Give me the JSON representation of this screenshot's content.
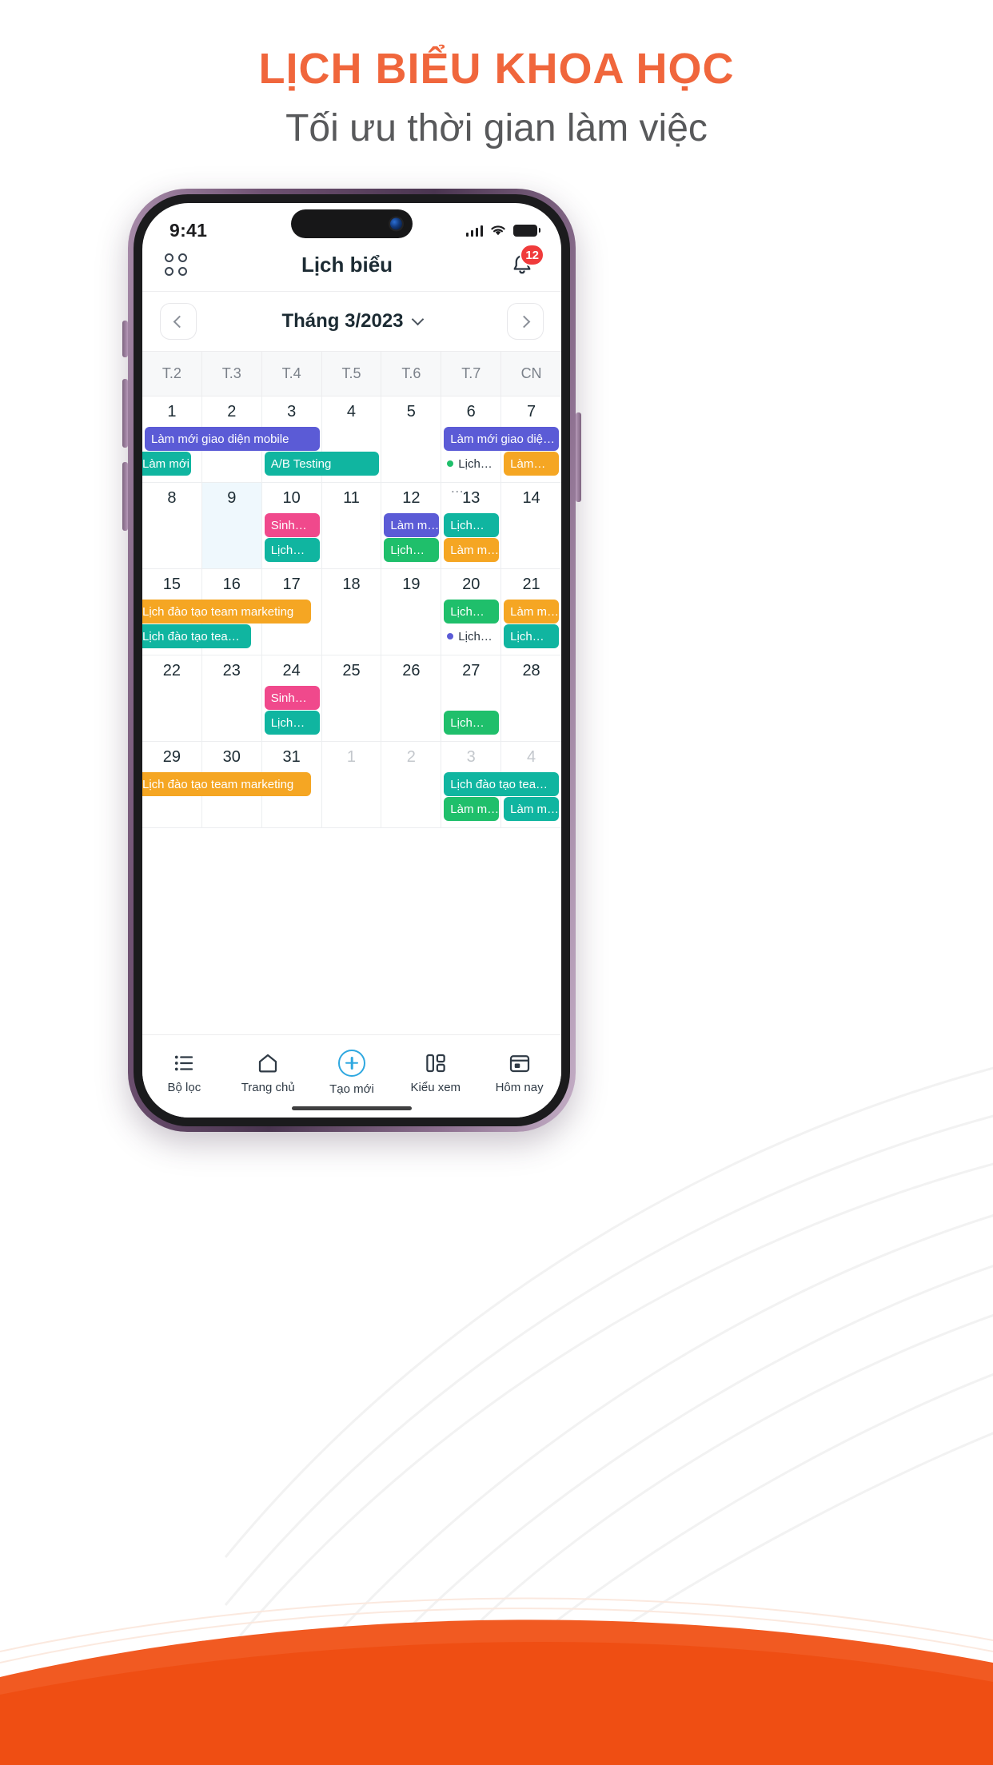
{
  "page": {
    "headline": "LỊCH BIỂU KHOA HỌC",
    "subhead": "Tối ưu thời gian làm việc",
    "accent_color": "#F0663C",
    "subhead_color": "#58595B"
  },
  "status_bar": {
    "time": "9:41",
    "signal_icon": "cellular-bars-icon",
    "wifi_icon": "wifi-icon",
    "battery_icon": "battery-icon"
  },
  "app_bar": {
    "grid_icon": "grid-apps-icon",
    "title": "Lịch biểu",
    "bell_icon": "bell-icon",
    "notification_count": "12",
    "badge_color": "#F03B3B"
  },
  "month_nav": {
    "prev_icon": "chevron-left-icon",
    "next_icon": "chevron-right-icon",
    "label": "Tháng 3/2023",
    "dropdown_icon": "chevron-down-icon"
  },
  "weekdays": [
    "T.2",
    "T.3",
    "T.4",
    "T.5",
    "T.6",
    "T.7",
    "CN"
  ],
  "days": [
    {
      "n": "1",
      "muted": false,
      "today": false
    },
    {
      "n": "2",
      "muted": false,
      "today": false
    },
    {
      "n": "3",
      "muted": false,
      "today": false
    },
    {
      "n": "4",
      "muted": false,
      "today": false
    },
    {
      "n": "5",
      "muted": false,
      "today": false
    },
    {
      "n": "6",
      "muted": false,
      "today": false
    },
    {
      "n": "7",
      "muted": false,
      "today": false
    },
    {
      "n": "8",
      "muted": false,
      "today": false
    },
    {
      "n": "9",
      "muted": false,
      "today": true
    },
    {
      "n": "10",
      "muted": false,
      "today": false
    },
    {
      "n": "11",
      "muted": false,
      "today": false
    },
    {
      "n": "12",
      "muted": false,
      "today": false
    },
    {
      "n": "13",
      "muted": false,
      "today": false
    },
    {
      "n": "14",
      "muted": false,
      "today": false
    },
    {
      "n": "15",
      "muted": false,
      "today": false
    },
    {
      "n": "16",
      "muted": false,
      "today": false
    },
    {
      "n": "17",
      "muted": false,
      "today": false
    },
    {
      "n": "18",
      "muted": false,
      "today": false
    },
    {
      "n": "19",
      "muted": false,
      "today": false
    },
    {
      "n": "20",
      "muted": false,
      "today": false
    },
    {
      "n": "21",
      "muted": false,
      "today": false
    },
    {
      "n": "22",
      "muted": false,
      "today": false
    },
    {
      "n": "23",
      "muted": false,
      "today": false
    },
    {
      "n": "24",
      "muted": false,
      "today": false
    },
    {
      "n": "25",
      "muted": false,
      "today": false
    },
    {
      "n": "26",
      "muted": false,
      "today": false
    },
    {
      "n": "27",
      "muted": false,
      "today": false
    },
    {
      "n": "28",
      "muted": false,
      "today": false
    },
    {
      "n": "29",
      "muted": false,
      "today": false
    },
    {
      "n": "30",
      "muted": false,
      "today": false
    },
    {
      "n": "31",
      "muted": false,
      "today": false
    },
    {
      "n": "1",
      "muted": true,
      "today": false
    },
    {
      "n": "2",
      "muted": true,
      "today": false
    },
    {
      "n": "3",
      "muted": true,
      "today": false
    },
    {
      "n": "4",
      "muted": true,
      "today": false
    }
  ],
  "event_colors": {
    "purple": "#5B5BD6",
    "teal": "#10B5A0",
    "green": "#1FBF6B",
    "orange": "#F5A623",
    "pink": "#F0498C"
  },
  "events": [
    {
      "label": "Làm mới giao diện mobile",
      "color": "#5B5BD6",
      "row": 0,
      "lane": 0,
      "col": 0,
      "span": 3,
      "style": "chip"
    },
    {
      "label": "Làm mới giao…",
      "color": "#10B5A0",
      "row": 0,
      "lane": 1,
      "col": 0,
      "span": 1,
      "style": "chip",
      "bleedLeft": true
    },
    {
      "label": "A/B Testing",
      "color": "#10B5A0",
      "row": 0,
      "lane": 1,
      "col": 2,
      "span": 2,
      "style": "chip"
    },
    {
      "label": "Làm mới giao diệ…",
      "color": "#5B5BD6",
      "row": 0,
      "lane": 0,
      "col": 5,
      "span": 2,
      "style": "chip"
    },
    {
      "label": "Lịch…",
      "color": "#1FBF6B",
      "row": 0,
      "lane": 1,
      "col": 5,
      "span": 1,
      "style": "dot"
    },
    {
      "label": "Làm…",
      "color": "#F5A623",
      "row": 0,
      "lane": 1,
      "col": 6,
      "span": 1,
      "style": "chip"
    },
    {
      "label": "…",
      "color": "#7b818a",
      "row": 0,
      "lane": 2,
      "col": 5,
      "span": 1,
      "style": "more"
    },
    {
      "label": "Sinh…",
      "color": "#F0498C",
      "row": 1,
      "lane": 0,
      "col": 2,
      "span": 1,
      "style": "chip"
    },
    {
      "label": "Lịch…",
      "color": "#10B5A0",
      "row": 1,
      "lane": 1,
      "col": 2,
      "span": 1,
      "style": "chip"
    },
    {
      "label": "Làm m…",
      "color": "#5B5BD6",
      "row": 1,
      "lane": 0,
      "col": 4,
      "span": 1,
      "style": "chip"
    },
    {
      "label": "Lịch…",
      "color": "#1FBF6B",
      "row": 1,
      "lane": 1,
      "col": 4,
      "span": 1,
      "style": "chip"
    },
    {
      "label": "Lịch…",
      "color": "#10B5A0",
      "row": 1,
      "lane": 0,
      "col": 5,
      "span": 1,
      "style": "chip"
    },
    {
      "label": "Làm m…",
      "color": "#F5A623",
      "row": 1,
      "lane": 1,
      "col": 5,
      "span": 1,
      "style": "chip"
    },
    {
      "label": "Lịch đào tạo team marketing",
      "color": "#F5A623",
      "row": 2,
      "lane": 0,
      "col": 0,
      "span": 3,
      "style": "chip",
      "bleedLeft": true
    },
    {
      "label": "Lịch đào tạo tea…",
      "color": "#10B5A0",
      "row": 2,
      "lane": 1,
      "col": 0,
      "span": 2,
      "style": "chip",
      "bleedLeft": true
    },
    {
      "label": "Lịch…",
      "color": "#1FBF6B",
      "row": 2,
      "lane": 0,
      "col": 5,
      "span": 1,
      "style": "chip"
    },
    {
      "label": "Làm m…",
      "color": "#F5A623",
      "row": 2,
      "lane": 0,
      "col": 6,
      "span": 1,
      "style": "chip"
    },
    {
      "label": "Lịch…",
      "color": "#5B5BD6",
      "row": 2,
      "lane": 1,
      "col": 5,
      "span": 1,
      "style": "dot"
    },
    {
      "label": "Lịch…",
      "color": "#10B5A0",
      "row": 2,
      "lane": 1,
      "col": 6,
      "span": 1,
      "style": "chip"
    },
    {
      "label": "Sinh…",
      "color": "#F0498C",
      "row": 3,
      "lane": 0,
      "col": 2,
      "span": 1,
      "style": "chip"
    },
    {
      "label": "Lịch…",
      "color": "#10B5A0",
      "row": 3,
      "lane": 1,
      "col": 2,
      "span": 1,
      "style": "chip"
    },
    {
      "label": "Lịch…",
      "color": "#1FBF6B",
      "row": 3,
      "lane": 1,
      "col": 5,
      "span": 1,
      "style": "chip"
    },
    {
      "label": "Lịch đào tạo team marketing",
      "color": "#F5A623",
      "row": 4,
      "lane": 0,
      "col": 0,
      "span": 3,
      "style": "chip",
      "bleedLeft": true
    },
    {
      "label": "Lịch đào tạo tea…",
      "color": "#10B5A0",
      "row": 4,
      "lane": 0,
      "col": 5,
      "span": 2,
      "style": "chip"
    },
    {
      "label": "Làm m…",
      "color": "#1FBF6B",
      "row": 4,
      "lane": 1,
      "col": 5,
      "span": 1,
      "style": "chip"
    },
    {
      "label": "Làm m…",
      "color": "#10B5A0",
      "row": 4,
      "lane": 1,
      "col": 6,
      "span": 1,
      "style": "chip"
    }
  ],
  "tabbar": [
    {
      "icon": "filter-list-icon",
      "label": "Bộ lọc"
    },
    {
      "icon": "home-icon",
      "label": "Trang chủ"
    },
    {
      "icon": "plus-circle-icon",
      "label": "Tạo mới"
    },
    {
      "icon": "layout-view-icon",
      "label": "Kiểu xem"
    },
    {
      "icon": "calendar-today-icon",
      "label": "Hôm nay"
    }
  ]
}
